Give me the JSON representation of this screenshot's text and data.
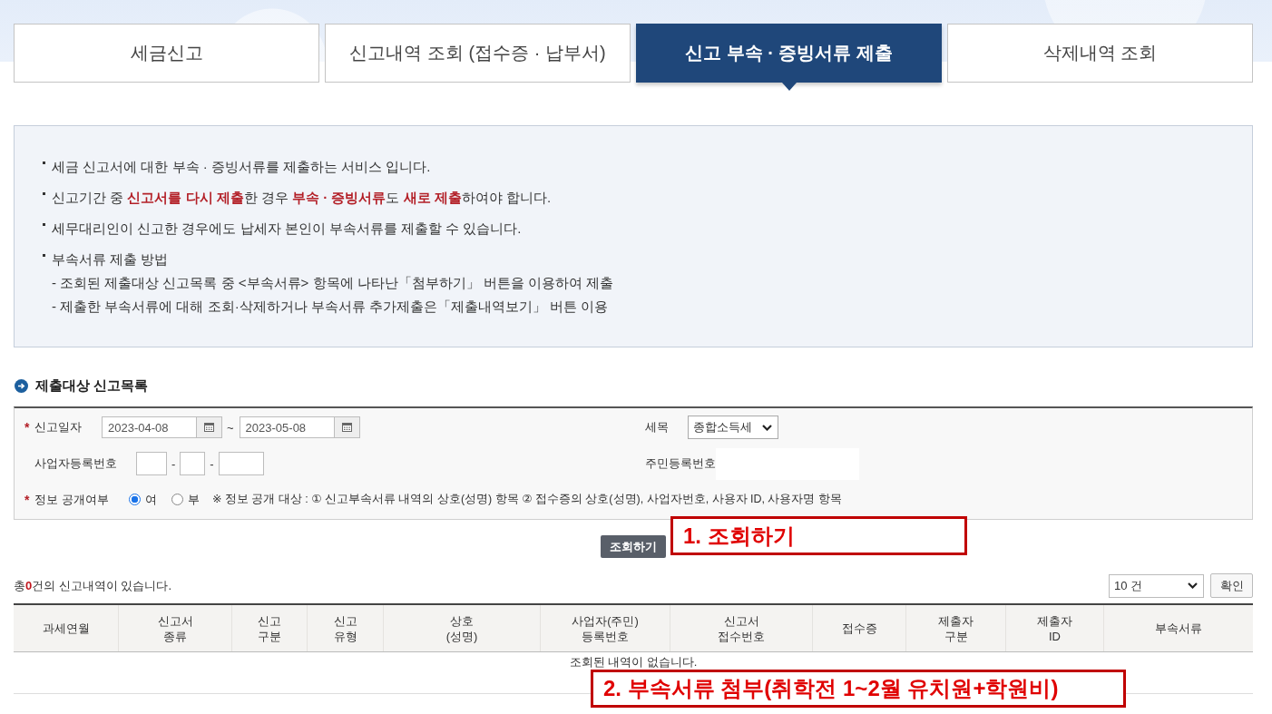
{
  "tabs": [
    {
      "label": "세금신고",
      "selected": false
    },
    {
      "label": "신고내역 조회 (접수증 · 납부서)",
      "selected": false
    },
    {
      "label": "신고 부속 · 증빙서류 제출",
      "selected": true
    },
    {
      "label": "삭제내역 조회",
      "selected": false
    }
  ],
  "notice": {
    "items": [
      {
        "text": "세금 신고서에 대한 부속 · 증빙서류를 제출하는 서비스 입니다."
      },
      {
        "text": "신고기간 중 **신고서를 다시 제출**한 경우 **부속 · 증빙서류**도 **새로 제출**하여야 합니다."
      },
      {
        "text": "세무대리인이 신고한 경우에도 납세자 본인이 부속서류를 제출할 수 있습니다."
      },
      {
        "text": "부속서류 제출 방법",
        "sub_items": [
          "- 조회된 제출대상 신고목록 중 <부속서류> 항목에 나타난「첨부하기」 버튼을 이용하여 제출",
          "- 제출한 부속서류에 대해 조회·삭제하거나 부속서류 추가제출은「제출내역보기」 버튼 이용"
        ]
      }
    ]
  },
  "section_title": "제출대상 신고목록",
  "search_form": {
    "report_date": {
      "required_mark": "*",
      "label": "신고일자",
      "from": "2023-04-08",
      "separator": "~",
      "to": "2023-05-08"
    },
    "tax_item": {
      "label": "세목",
      "value": "종합소득세"
    },
    "business_number": {
      "label": "사업자등록번호",
      "separators": [
        "-",
        "-"
      ]
    },
    "resident_number": {
      "label": "주민등록번호"
    },
    "disclosure": {
      "required_mark": "*",
      "label": "정보 공개여부",
      "options": [
        {
          "label": "여",
          "selected": true
        },
        {
          "label": "부",
          "selected": false
        }
      ],
      "note": "※ 정보 공개 대상 : ① 신고부속서류 내역의 상호(성명) 항목 ② 접수증의 상호(성명), 사업자번호, 사용자 ID, 사용자명 항목"
    }
  },
  "search_button": "조회하기",
  "results": {
    "summary": "총**0**건의 신고내역이 있습니다.",
    "page_size": "10 건",
    "confirm_button": "확인",
    "columns": [
      "과세연월",
      "신고서\n종류",
      "신고\n구분",
      "신고\n유형",
      "상호\n(성명)",
      "사업자(주민)\n등록번호",
      "신고서\n접수번호",
      "접수증",
      "제출자\n구분",
      "제출자\nID",
      "부속서류"
    ],
    "empty_message": "조회된 내역이 없습니다."
  },
  "annotations": [
    {
      "text": "1. 조회하기"
    },
    {
      "text": "2. 부속서류 첨부(취학전 1~2월 유치원+학원비)"
    }
  ]
}
